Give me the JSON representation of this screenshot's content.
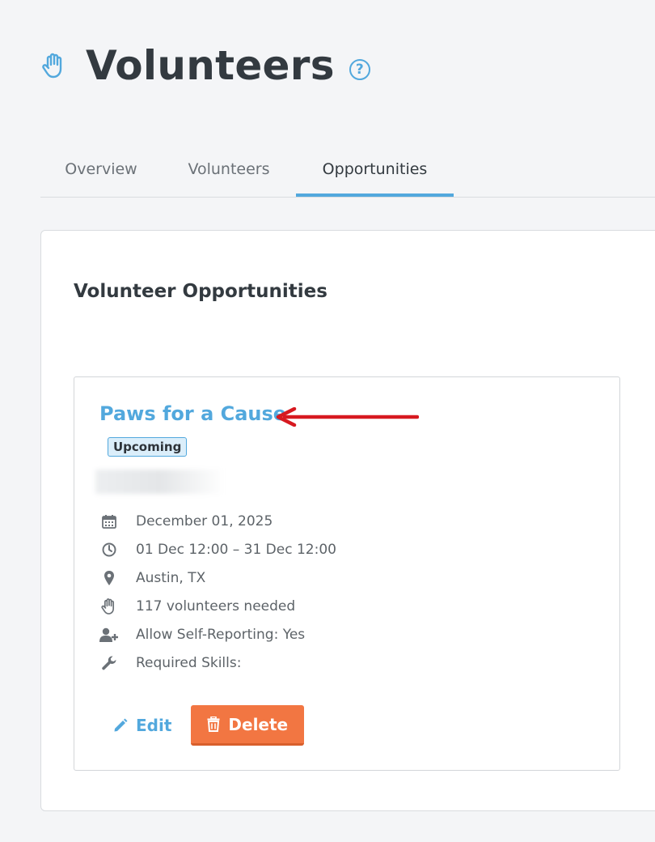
{
  "header": {
    "title": "Volunteers",
    "help_label": "?",
    "icon": "hand-icon"
  },
  "tabs": [
    {
      "label": "Overview",
      "active": false
    },
    {
      "label": "Volunteers",
      "active": false
    },
    {
      "label": "Opportunities",
      "active": true
    }
  ],
  "panel": {
    "title": "Volunteer Opportunities",
    "opportunity": {
      "name": "Paws for a Cause",
      "status": "Upcoming",
      "details": [
        {
          "icon": "calendar-icon",
          "text": "December 01, 2025"
        },
        {
          "icon": "clock-icon",
          "text": "01 Dec 12:00 – 31 Dec 12:00"
        },
        {
          "icon": "map-pin-icon",
          "text": "Austin, TX"
        },
        {
          "icon": "hand-icon",
          "text": "117 volunteers needed"
        },
        {
          "icon": "user-plus-icon",
          "text": "Allow Self-Reporting: Yes"
        },
        {
          "icon": "wrench-icon",
          "text": "Required Skills:"
        }
      ],
      "edit_label": "Edit",
      "delete_label": "Delete"
    }
  },
  "colors": {
    "accent": "#52a8dd",
    "delete": "#f27642",
    "annotation_arrow": "#d71920"
  }
}
